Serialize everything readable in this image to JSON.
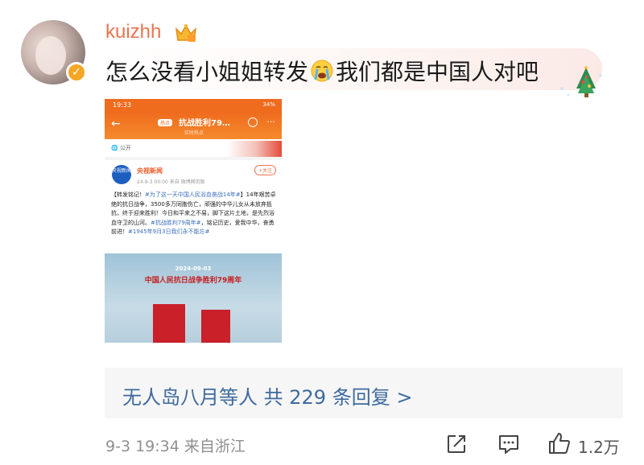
{
  "comment": {
    "username": "kuizhh",
    "text_before_emoji": "怎么没看小姐姐转发",
    "text_after_emoji": "我们都是中国人对吧",
    "emoji": "crying-face-icon",
    "badge": "crown-icon",
    "decoration": "christmas-tree-icon"
  },
  "embedded_screenshot": {
    "status_time": "19:33",
    "battery": "34%",
    "hot_tag": "热点",
    "nav_title": "抗战胜利79…",
    "nav_subtitle": "实时热点",
    "public_label": "公开",
    "author": "央视新闻",
    "logo_text": "央视新闻",
    "meta": "24-9-3 00:00  来自 微博网页版",
    "follow": "+关注",
    "body_1": "【转发铭记！",
    "tag_1": "#为了这一天中国人民浴血奋战14年#",
    "body_2": "】14年艰苦卓绝的抗日战争，3500多万同胞伤亡，顽强的中华儿女从未放弃抵抗，终于迎来胜利！今日和平来之不易，脚下这片土地，是先烈浴血守卫的山河。",
    "tag_2": "#抗战胜利79周年#",
    "body_3": "，铭记历史，爱我中华，奋勇前进！",
    "tag_3": "#1945年9月3日我们永不能忘#",
    "poster_date": "2024-09-03",
    "poster_title": "中国人民抗日战争胜利79周年"
  },
  "replies": {
    "text": "无人岛八月等人  共 229 条回复 >"
  },
  "footer": {
    "timestamp": "9-3 19:34  来自浙江",
    "like_count": "1.2万"
  }
}
